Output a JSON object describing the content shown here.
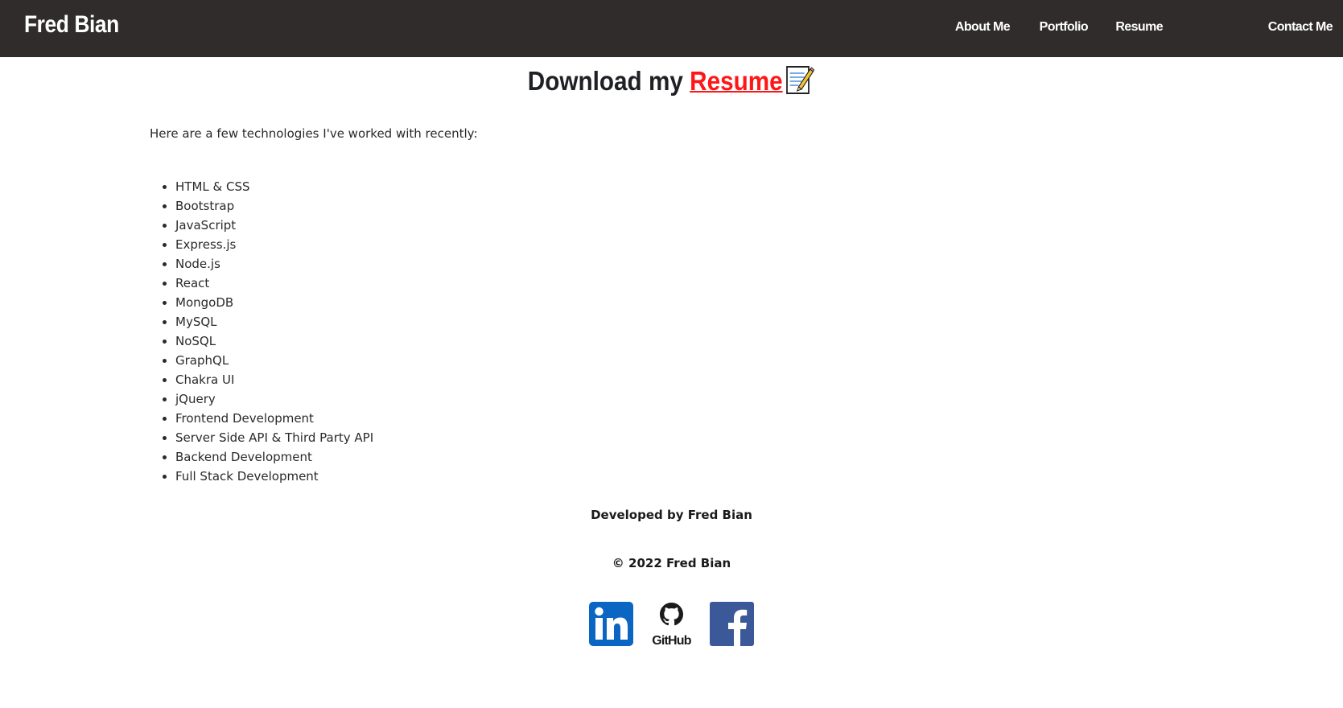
{
  "header": {
    "brand": "Fred Bian",
    "nav": [
      {
        "label": "About Me"
      },
      {
        "label": "Portfolio"
      },
      {
        "label": "Resume"
      },
      {
        "label": "Contact Me"
      }
    ],
    "background": "#302c2c"
  },
  "main": {
    "heading_prefix": "Download my ",
    "heading_link": "Resume",
    "heading_icon": "memo-icon",
    "link_color": "#ff1616",
    "intro": "Here are a few technologies I've worked with recently:",
    "technologies": [
      "HTML & CSS",
      "Bootstrap",
      "JavaScript",
      "Express.js",
      "Node.js",
      "React",
      "MongoDB",
      "MySQL",
      "NoSQL",
      "GraphQL",
      "Chakra UI",
      "jQuery",
      "Frontend Development",
      "Server Side API & Third Party API",
      "Backend Development",
      "Full Stack Development"
    ]
  },
  "footer": {
    "developed_by": "Developed by Fred Bian",
    "copyright": "© 2022 Fred Bian",
    "social": [
      {
        "icon": "linkedin-icon",
        "color": "#0a66c2"
      },
      {
        "icon": "github-icon",
        "label": "GitHub",
        "color": "#1a1a1a"
      },
      {
        "icon": "facebook-icon",
        "color": "#3b5998"
      }
    ]
  }
}
